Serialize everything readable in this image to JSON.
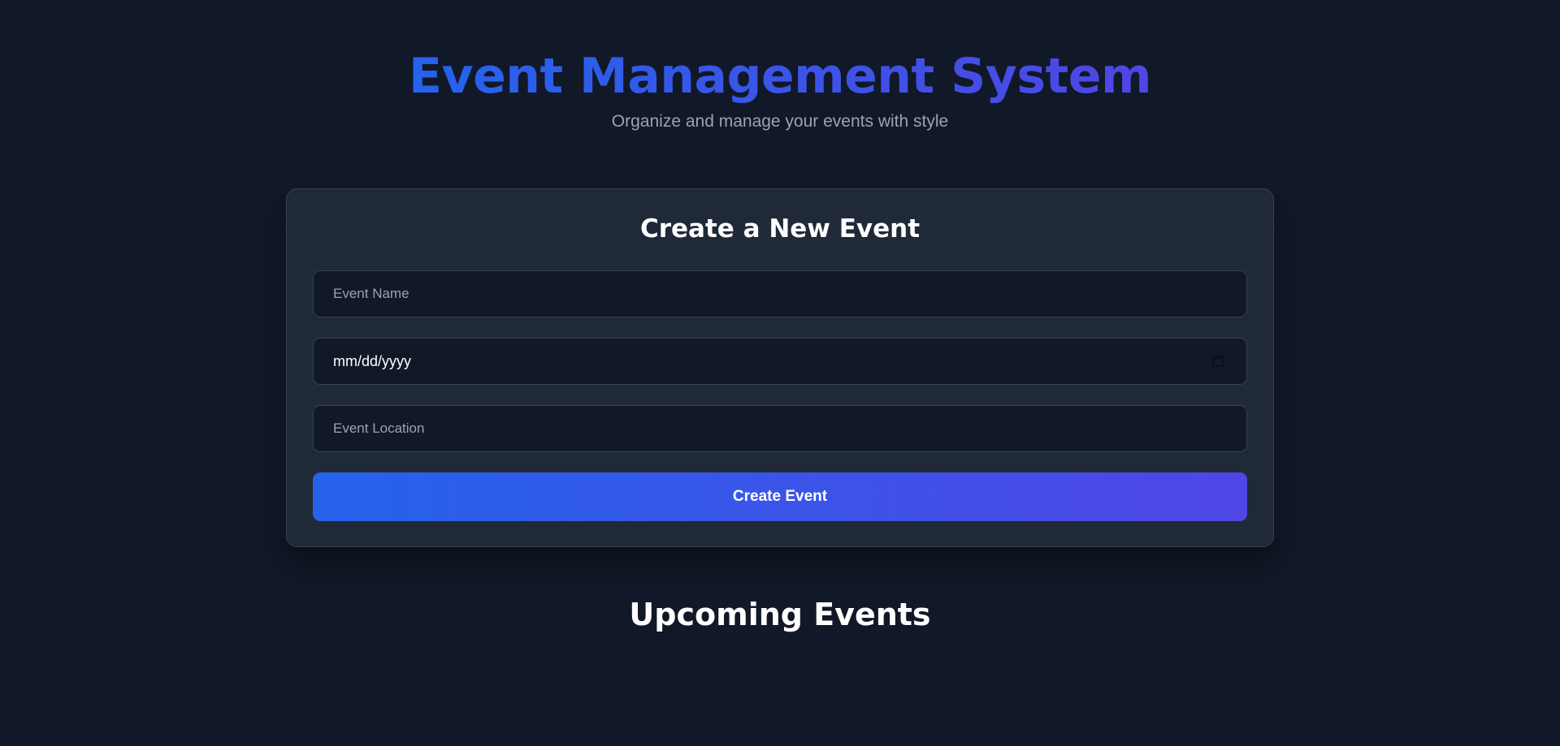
{
  "header": {
    "title": "Event Management System",
    "subtitle": "Organize and manage your events with style"
  },
  "form": {
    "title": "Create a New Event",
    "event_name_placeholder": "Event Name",
    "date_value": "mm/dd/yyyy",
    "event_location_placeholder": "Event Location",
    "submit_label": "Create Event"
  },
  "events": {
    "title": "Upcoming Events"
  },
  "colors": {
    "background": "#111827",
    "card": "#1f2937",
    "accent_start": "#2563eb",
    "accent_end": "#4f46e5",
    "muted_text": "#9ca3af"
  }
}
